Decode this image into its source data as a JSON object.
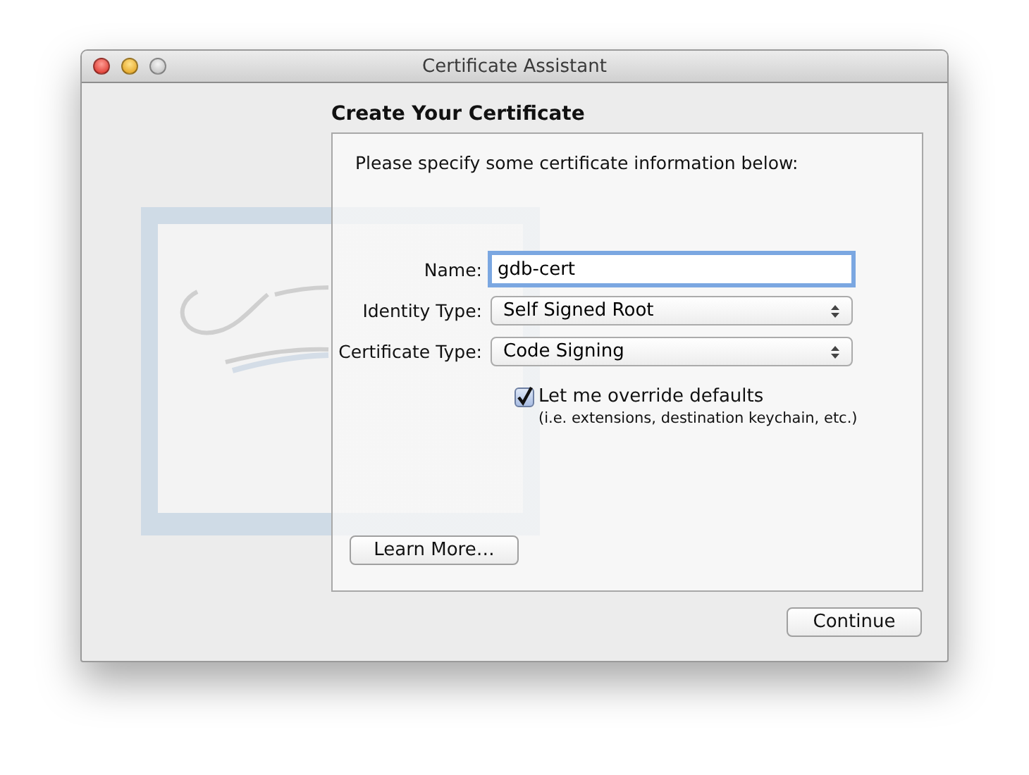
{
  "window": {
    "title": "Certificate Assistant"
  },
  "heading": "Create Your Certificate",
  "instruction": "Please specify some certificate information below:",
  "fields": [
    {
      "kind": "text",
      "label": "Name:",
      "value": "gdb-cert",
      "focused": true
    },
    {
      "kind": "popup",
      "label": "Identity Type:",
      "value": "Self Signed Root",
      "focused": false
    },
    {
      "kind": "popup",
      "label": "Certificate Type:",
      "value": "Code Signing",
      "focused": false
    }
  ],
  "override": {
    "label": "Let me override defaults",
    "note": "(i.e. extensions, destination keychain, etc.)",
    "checked": true
  },
  "buttons": {
    "learn_more": "Learn More…",
    "continue": "Continue"
  }
}
